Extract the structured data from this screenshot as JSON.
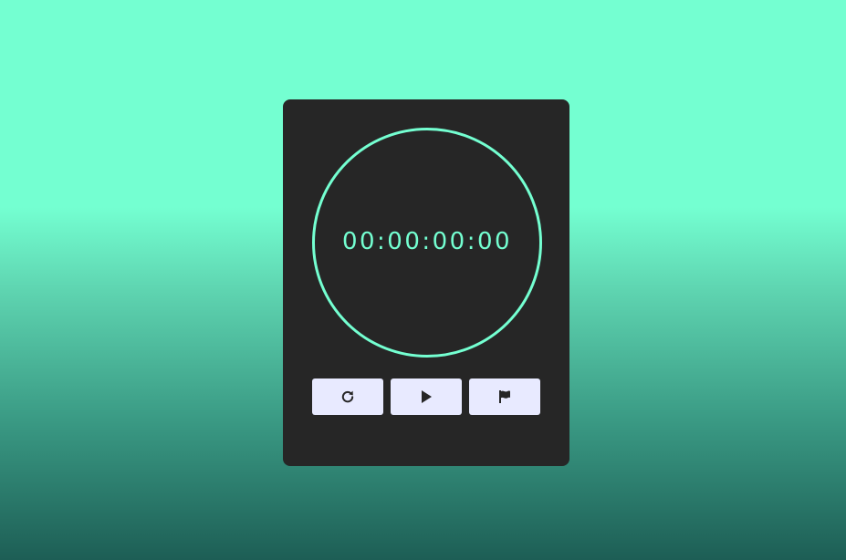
{
  "stopwatch": {
    "time": "00:00:00:00",
    "accent_color": "#74ffd1",
    "card_color": "#262626",
    "button_color": "#e8eaff"
  },
  "controls": [
    {
      "name": "reset",
      "icon": "reset-icon"
    },
    {
      "name": "start",
      "icon": "play-icon"
    },
    {
      "name": "lap",
      "icon": "flag-icon"
    }
  ]
}
